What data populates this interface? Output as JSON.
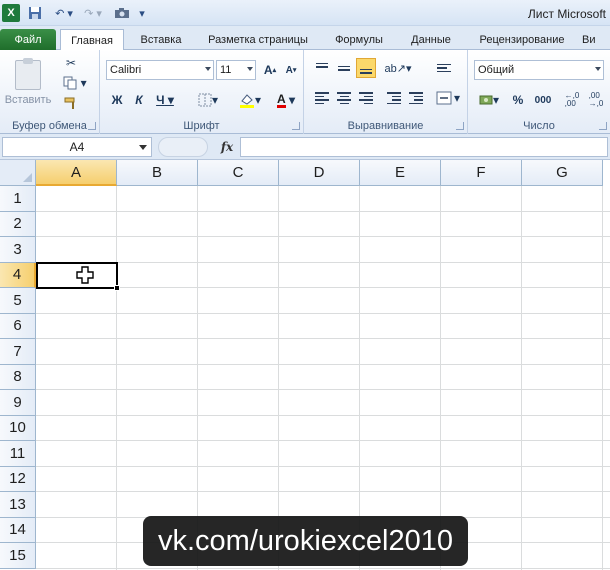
{
  "title_bar": {
    "app_icon_letter": "X",
    "window_title": "Лист Microsoft"
  },
  "tabs": {
    "file": "Файл",
    "home": "Главная",
    "insert": "Вставка",
    "page_layout": "Разметка страницы",
    "formulas": "Формулы",
    "data": "Данные",
    "review": "Рецензирование",
    "view": "Ви"
  },
  "ribbon": {
    "clipboard": {
      "paste_label": "Вставить",
      "group_label": "Буфер обмена"
    },
    "font": {
      "font_name": "Calibri",
      "font_size": "11",
      "bold": "Ж",
      "italic": "К",
      "underline": "Ч",
      "group_label": "Шрифт"
    },
    "alignment": {
      "group_label": "Выравнивание"
    },
    "number": {
      "format": "Общий",
      "percent": "%",
      "thousands": "000",
      "group_label": "Число"
    }
  },
  "formula_bar": {
    "name_box": "A4",
    "fx": "fx",
    "formula": ""
  },
  "grid": {
    "columns": [
      "A",
      "B",
      "C",
      "D",
      "E",
      "F",
      "G"
    ],
    "rows": [
      "1",
      "2",
      "3",
      "4",
      "5",
      "6",
      "7",
      "8",
      "9",
      "10",
      "11",
      "12",
      "13",
      "14",
      "15"
    ],
    "active_column": "A",
    "active_row": "4"
  },
  "colors": {
    "file_tab": "#2a7f37",
    "active_header": "#f6cf6e",
    "selection_border": "#000000"
  },
  "watermark": "vk.com/urokiexcel2010"
}
